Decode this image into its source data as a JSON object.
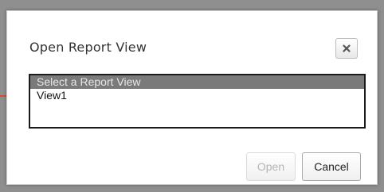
{
  "dialog": {
    "title": "Open Report View",
    "close_icon": "close-icon",
    "list": {
      "options": [
        {
          "label": "Select a Report View",
          "selected": true
        },
        {
          "label": "View1",
          "selected": false
        }
      ]
    },
    "buttons": {
      "open_label": "Open",
      "open_disabled": true,
      "cancel_label": "Cancel"
    }
  },
  "colors": {
    "selected_row": "#7a7a7a",
    "disabled_text": "#b5b5b5"
  }
}
